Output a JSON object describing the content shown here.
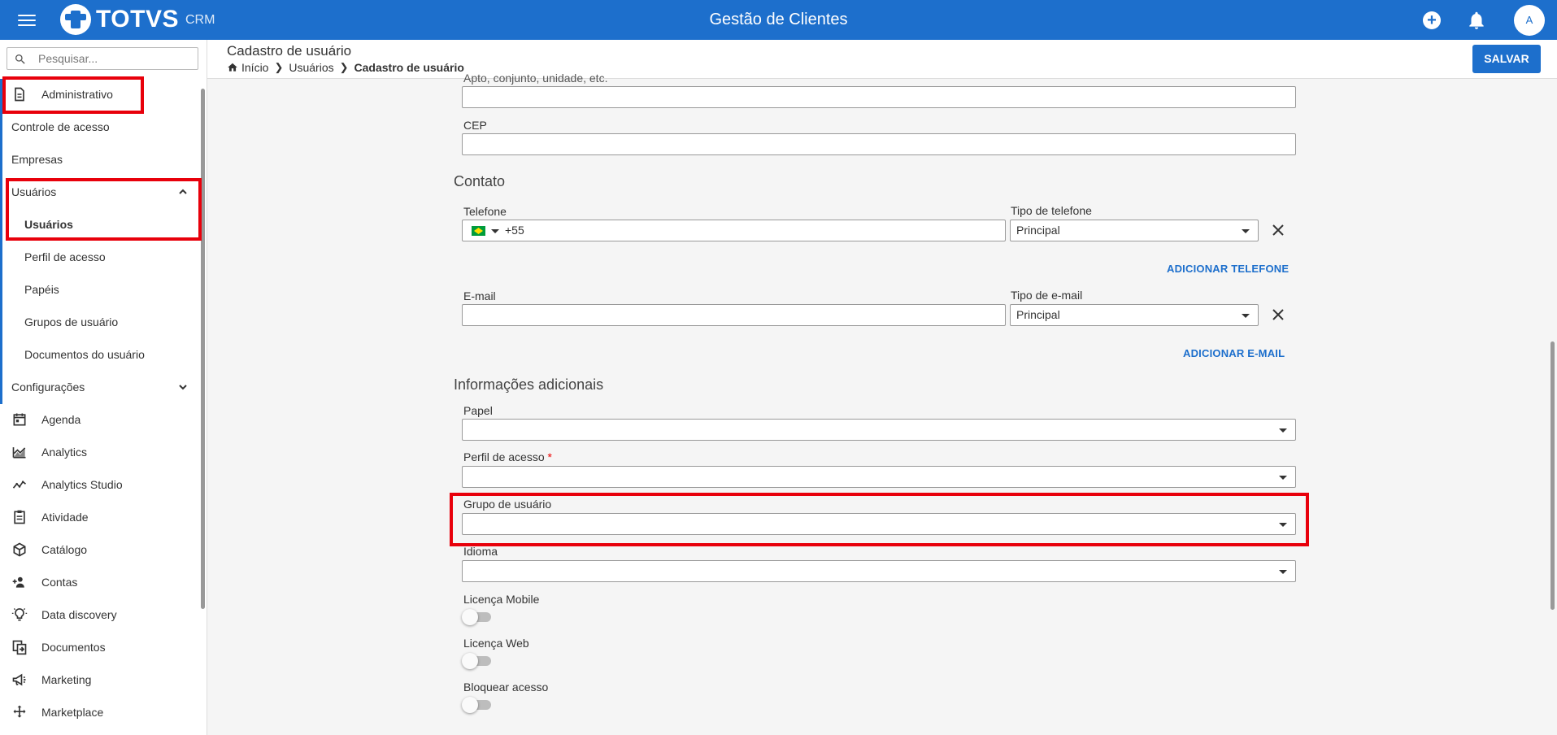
{
  "topbar": {
    "logo_text": "TOTVS",
    "logo_sub": "CRM",
    "app_title": "Gestão de Clientes",
    "avatar_initial": "A"
  },
  "page": {
    "title": "Cadastro de usuário",
    "breadcrumb": [
      "Início",
      "Usuários",
      "Cadastro de usuário"
    ],
    "save_label": "SALVAR"
  },
  "sidebar": {
    "search_placeholder": "Pesquisar...",
    "items": [
      {
        "label": "Administrativo",
        "icon": "document-icon"
      },
      {
        "label": "Controle de acesso"
      },
      {
        "label": "Empresas"
      },
      {
        "label": "Usuários",
        "expanded": true
      },
      {
        "label": "Usuários",
        "active": true
      },
      {
        "label": "Perfil de acesso"
      },
      {
        "label": "Papéis"
      },
      {
        "label": "Grupos de usuário"
      },
      {
        "label": "Documentos do usuário"
      },
      {
        "label": "Configurações",
        "expanded": false
      },
      {
        "label": "Agenda",
        "icon": "calendar-icon"
      },
      {
        "label": "Analytics",
        "icon": "area-chart-icon"
      },
      {
        "label": "Analytics Studio",
        "icon": "line-chart-icon"
      },
      {
        "label": "Atividade",
        "icon": "clipboard-icon"
      },
      {
        "label": "Catálogo",
        "icon": "cube-icon"
      },
      {
        "label": "Contas",
        "icon": "people-add-icon"
      },
      {
        "label": "Data discovery",
        "icon": "lightbulb-icon"
      },
      {
        "label": "Documentos",
        "icon": "documents-icon"
      },
      {
        "label": "Marketing",
        "icon": "megaphone-icon"
      },
      {
        "label": "Marketplace",
        "icon": "move-arrows-icon"
      }
    ]
  },
  "form": {
    "address_complement_label": "Apto, conjunto, unidade, etc.",
    "cep_label": "CEP",
    "contato_title": "Contato",
    "telefone_label": "Telefone",
    "telefone_value": "+55",
    "tipo_telefone_label": "Tipo de telefone",
    "tipo_telefone_value": "Principal",
    "add_phone_label": "ADICIONAR TELEFONE",
    "email_label": "E-mail",
    "tipo_email_label": "Tipo de e-mail",
    "tipo_email_value": "Principal",
    "add_email_label": "ADICIONAR E-MAIL",
    "info_title": "Informações adicionais",
    "papel_label": "Papel",
    "perfil_label": "Perfil de acesso",
    "perfil_required": "*",
    "grupo_label": "Grupo de usuário",
    "idioma_label": "Idioma",
    "licenca_mobile_label": "Licença Mobile",
    "licenca_web_label": "Licença Web",
    "bloquear_label": "Bloquear acesso"
  },
  "colors": {
    "primary": "#1d6fcc",
    "highlight": "#e8000b"
  }
}
